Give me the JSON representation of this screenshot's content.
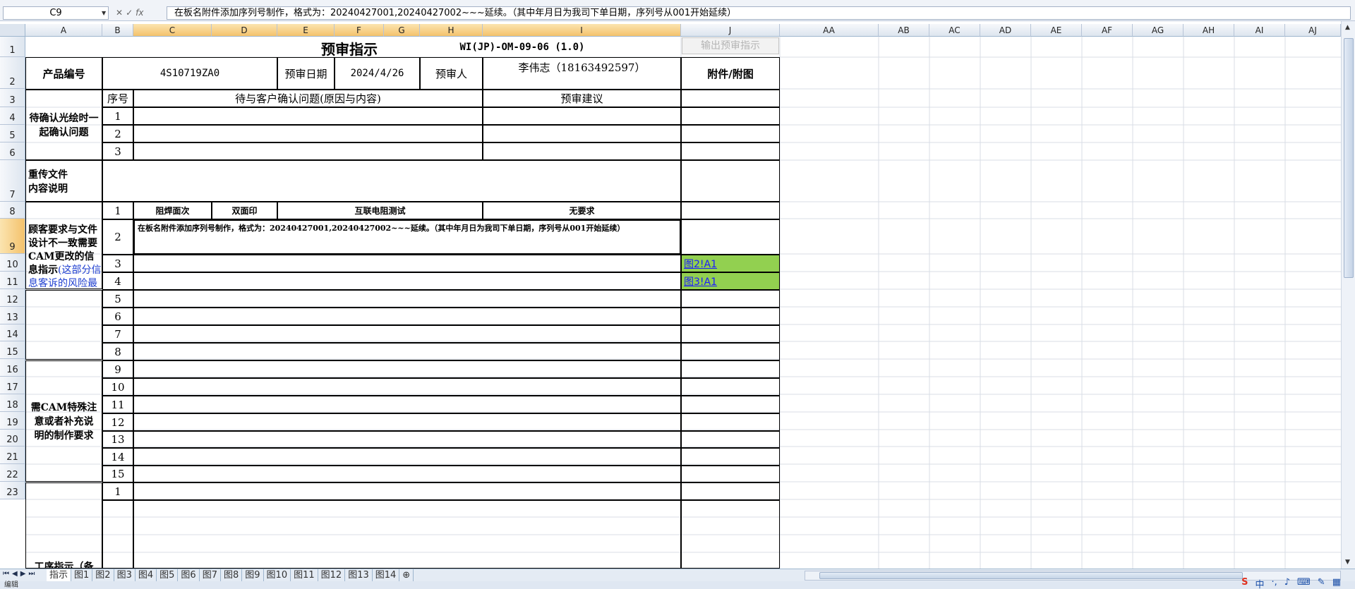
{
  "formula_bar": {
    "cell_ref": "C9",
    "fx_label": "fx",
    "content": "在板名附件添加序列号制作，格式为：20240427001,20240427002~~~延续。（其中年月日为我司下单日期，序列号从001开始延续）"
  },
  "columns": [
    "A",
    "B",
    "C",
    "D",
    "E",
    "F",
    "G",
    "H",
    "I",
    "J",
    "AA",
    "AB",
    "AC",
    "AD",
    "AE",
    "AF",
    "AG",
    "AH",
    "AI",
    "AJ"
  ],
  "rows": [
    "1",
    "2",
    "3",
    "4",
    "5",
    "6",
    "7",
    "8",
    "9",
    "10",
    "11",
    "12",
    "13",
    "14",
    "15",
    "16",
    "17",
    "18",
    "19",
    "20",
    "21",
    "22",
    "23"
  ],
  "header": {
    "title": "预审指示",
    "doc_no": "WI(JP)-OM-09-06 (1.0)",
    "export_button": "输出预审指示",
    "product_no_label": "产品编号",
    "product_no": "4S10719ZA0",
    "review_date_label": "预审日期",
    "review_date": "2024/4/26",
    "reviewer_label": "预审人",
    "reviewer": "李伟志（18163492597）",
    "attachment_label": "附件/附图"
  },
  "sec1": {
    "label": "待确认光绘时一起确认问题",
    "seq_header": "序号",
    "issue_header": "待与客户确认问题(原因与内容)",
    "suggest_header": "预审建议",
    "seq": [
      "1",
      "2",
      "3"
    ]
  },
  "sec2": {
    "label": "重传文件\n内容说明"
  },
  "sec3": {
    "label_black": "顾客要求与文件设计不一致需要CAM更改的信息指示",
    "label_blue": "(这部分信息客诉的风险最高)",
    "row1": {
      "seq": "1",
      "c1": "阻焊面次",
      "c2": "双面印",
      "c3": "互联电阻测试",
      "c4": "无要求"
    },
    "row2": {
      "seq": "2",
      "text": "在板名附件添加序列号制作，格式为：20240427001,20240427002~~~延续。（其中年月日为我司下单日期，序列号从001开始延续）"
    },
    "row3": {
      "seq": "3",
      "link": "图2!A1"
    },
    "row4": {
      "seq": "4",
      "link": "图3!A1"
    },
    "more_seq": [
      "5",
      "6",
      "7",
      "8"
    ]
  },
  "sec4": {
    "label": "需CAM特殊注意或者补充说明的制作要求",
    "seq": [
      "9",
      "10",
      "11",
      "12",
      "13",
      "14",
      "15"
    ]
  },
  "sec5": {
    "label": "工序指示（备",
    "seq": [
      "1"
    ]
  },
  "sheet_tabs": [
    "指示",
    "图1",
    "图2",
    "图3",
    "图4",
    "图5",
    "图6",
    "图7",
    "图8",
    "图9",
    "图10",
    "图11",
    "图12",
    "图13",
    "图14"
  ],
  "status": "编辑"
}
